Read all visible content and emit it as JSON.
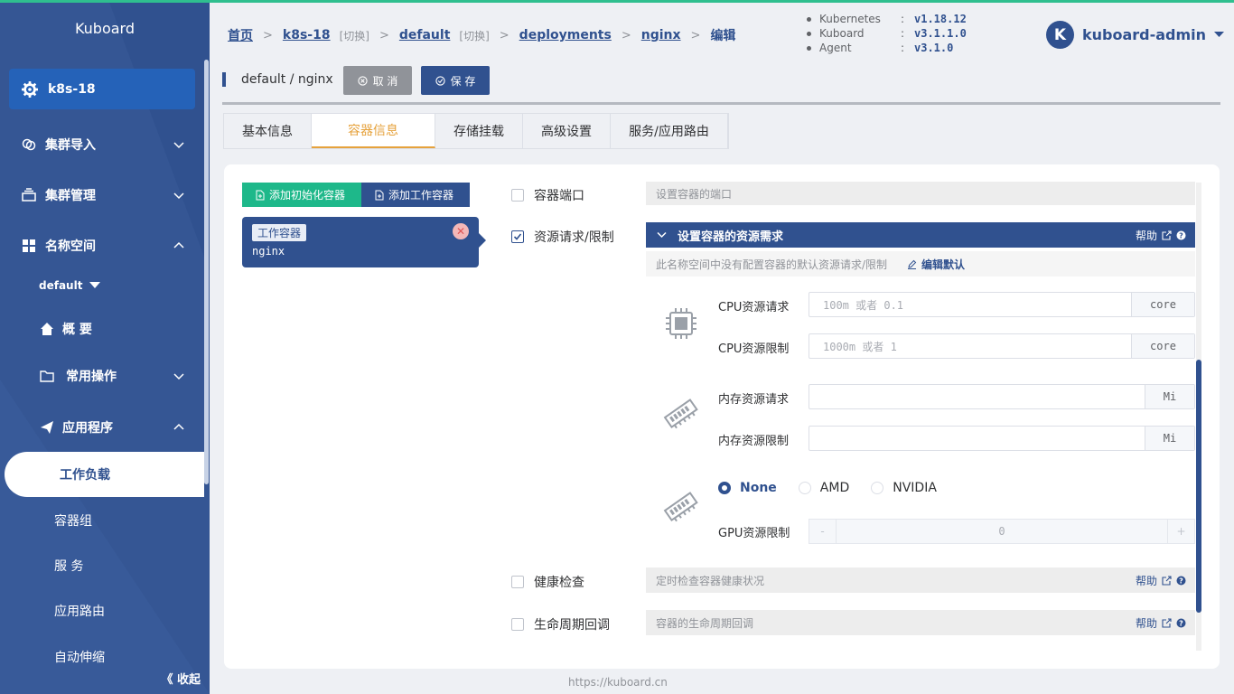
{
  "app": {
    "title": "Kuboard",
    "footer": "https://kuboard.cn"
  },
  "sidebar": {
    "cluster": "k8s-18",
    "items": [
      {
        "label": "集群导入",
        "icon": "link-icon"
      },
      {
        "label": "集群管理",
        "icon": "stack-icon"
      },
      {
        "label": "名称空间",
        "icon": "grid-icon"
      }
    ],
    "namespace": "default",
    "ns_items": [
      {
        "label": "概 要",
        "icon": "home-icon"
      },
      {
        "label": "常用操作",
        "icon": "folder-icon"
      },
      {
        "label": "应用程序",
        "icon": "send-icon"
      }
    ],
    "app_items": [
      "工作负载",
      "容器组",
      "服 务",
      "应用路由",
      "自动伸缩"
    ],
    "collapse": "《 收起"
  },
  "breadcrumb": {
    "home": "首页",
    "cluster": "k8s-18",
    "switch": "[切换]",
    "namespace": "default",
    "kind": "deployments",
    "name": "nginx",
    "action": "编辑"
  },
  "versions": [
    {
      "key": "Kubernetes",
      "value": "v1.18.12"
    },
    {
      "key": "Kuboard",
      "value": "v3.1.1.0"
    },
    {
      "key": "Agent",
      "value": "v3.1.0"
    }
  ],
  "user": {
    "initial": "K",
    "name": "kuboard-admin"
  },
  "toolbar": {
    "title": "default / nginx",
    "cancel": "取 消",
    "save": "保 存"
  },
  "tabs": [
    "基本信息",
    "容器信息",
    "存储挂载",
    "高级设置",
    "服务/应用路由"
  ],
  "containers": {
    "add_init": "添加初始化容器",
    "add_work": "添加工作容器",
    "card_tag": "工作容器",
    "card_name": "nginx"
  },
  "options": {
    "port": {
      "label": "容器端口",
      "hint": "设置容器的端口"
    },
    "resources": {
      "label": "资源请求/限制",
      "header": "设置容器的资源需求",
      "help": "帮助",
      "note": "此名称空间中没有配置容器的默认资源请求/限制",
      "edit": "编辑默认"
    },
    "health": {
      "label": "健康检查",
      "hint": "定时检查容器健康状况",
      "help": "帮助"
    },
    "lifecycle": {
      "label": "生命周期回调",
      "hint": "容器的生命周期回调",
      "help": "帮助"
    }
  },
  "fields": {
    "cpu_req": {
      "label": "CPU资源请求",
      "placeholder": "100m 或者 0.1",
      "unit": "core"
    },
    "cpu_lim": {
      "label": "CPU资源限制",
      "placeholder": "1000m 或者 1",
      "unit": "core"
    },
    "mem_req": {
      "label": "内存资源请求",
      "placeholder": "",
      "unit": "Mi"
    },
    "mem_lim": {
      "label": "内存资源限制",
      "placeholder": "",
      "unit": "Mi"
    },
    "gpu_options": [
      "None",
      "AMD",
      "NVIDIA"
    ],
    "gpu_lim": {
      "label": "GPU资源限制",
      "value": "0",
      "minus": "-",
      "plus": "+"
    }
  },
  "colors": {
    "primary": "#30518f",
    "accent": "#e6a23c",
    "green": "#1eb88a"
  }
}
